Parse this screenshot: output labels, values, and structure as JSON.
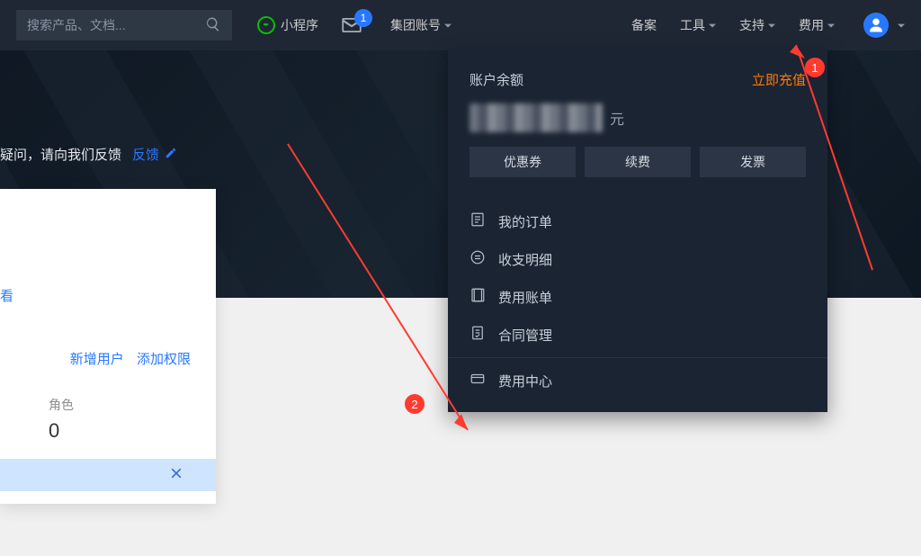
{
  "search": {
    "placeholder": "搜索产品、文档..."
  },
  "nav": {
    "miniprogram": "小程序",
    "mail_badge": "1",
    "group_account": "集团账号",
    "beian": "备案",
    "tools": "工具",
    "support": "支持",
    "fees": "费用"
  },
  "hero": {
    "prefix": "疑问，请向我们反馈",
    "feedback": "反馈"
  },
  "card": {
    "view": "看",
    "add_user": "新增用户",
    "add_perm": "添加权限",
    "role_label": "角色",
    "role_count": "0"
  },
  "dropdown": {
    "balance_label": "账户余额",
    "recharge": "立即充值",
    "yuan": "元",
    "btn_coupon": "优惠券",
    "btn_renew": "续费",
    "btn_invoice": "发票",
    "items": {
      "orders": "我的订单",
      "transactions": "收支明细",
      "bill": "费用账单",
      "contract": "合同管理",
      "center": "费用中心"
    }
  },
  "annotations": {
    "one": "1",
    "two": "2"
  }
}
